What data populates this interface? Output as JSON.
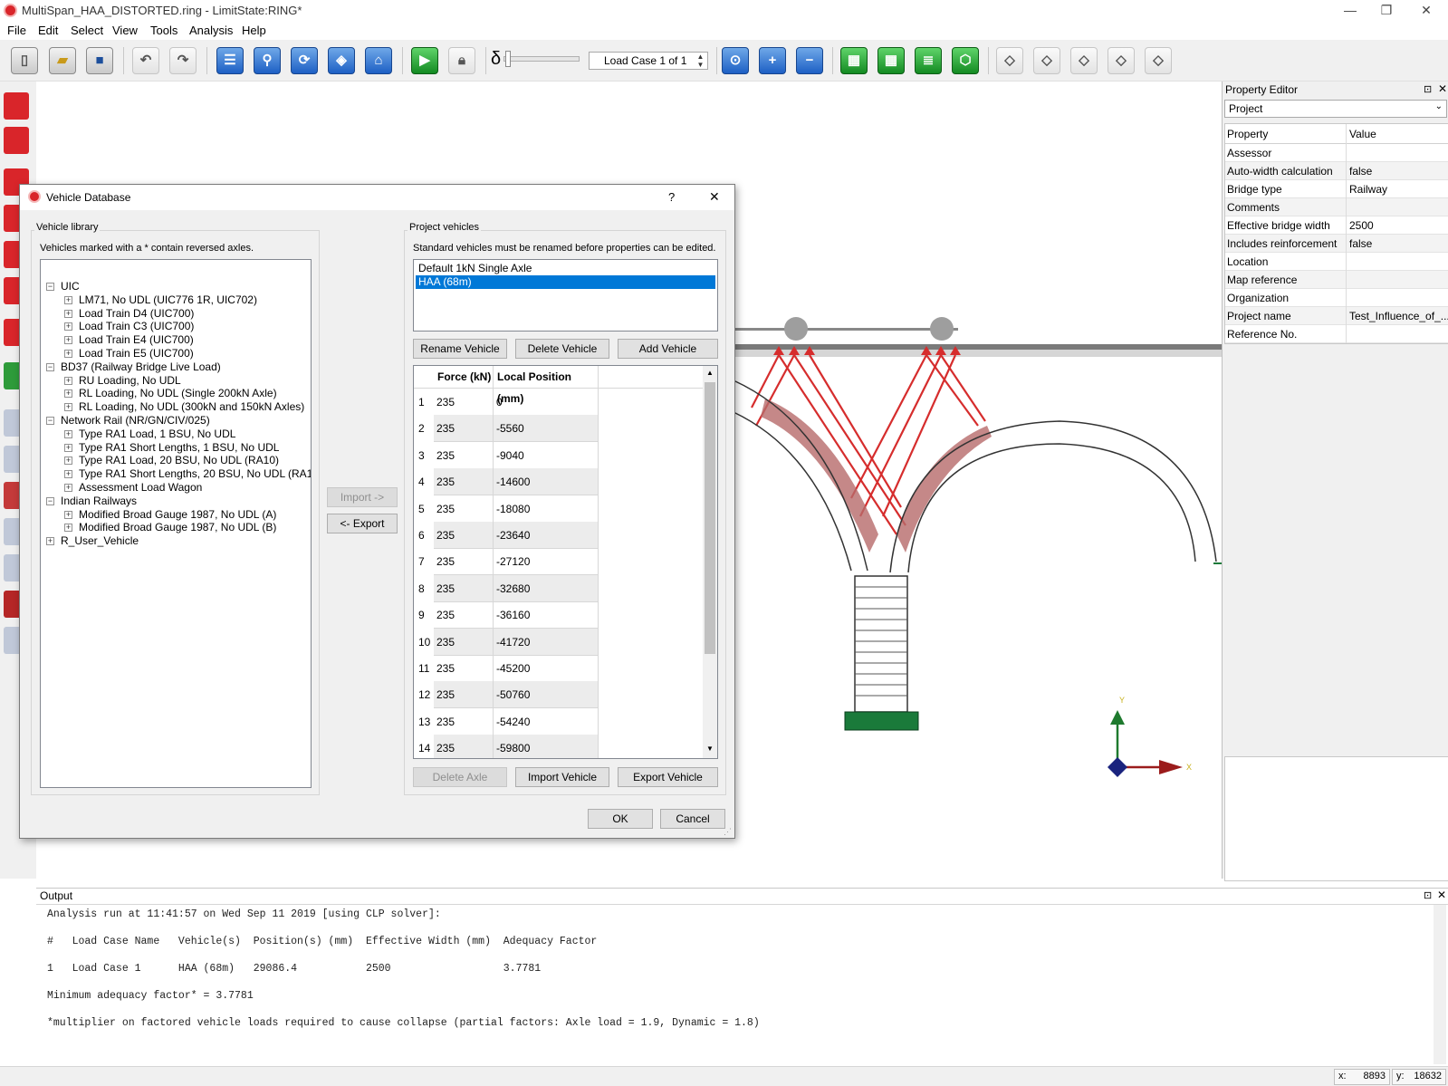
{
  "app": {
    "title": "MultiSpan_HAA_DISTORTED.ring - LimitState:RING*",
    "window_controls": [
      "—",
      "❐",
      "✕"
    ]
  },
  "menu": [
    "File",
    "Edit",
    "Select",
    "View",
    "Tools",
    "Analysis",
    "Help"
  ],
  "toolbar": {
    "delta_symbol": "δ",
    "load_case": "Load Case 1 of 1",
    "buttons": [
      "new-file",
      "open-folder",
      "save",
      "undo",
      "redo",
      "properties-sheet",
      "select-tool",
      "rotate-view",
      "tag",
      "bridge-tool",
      "run-analysis",
      "lock",
      "zoom-fit",
      "zoom-in",
      "zoom-out",
      "view-layer-1",
      "view-layer-2",
      "view-layer-3",
      "view-3d",
      "view-a",
      "view-b",
      "view-c",
      "view-d",
      "view-e"
    ]
  },
  "property_editor": {
    "title": "Property Editor",
    "selector": "Project",
    "headers": {
      "property": "Property",
      "value": "Value"
    },
    "rows": [
      {
        "property": "Assessor",
        "value": ""
      },
      {
        "property": "Auto-width calculation",
        "value": "false"
      },
      {
        "property": "Bridge type",
        "value": "Railway"
      },
      {
        "property": "Comments",
        "value": ""
      },
      {
        "property": "Effective bridge width",
        "value": "2500"
      },
      {
        "property": "Includes reinforcement",
        "value": "false"
      },
      {
        "property": "Location",
        "value": ""
      },
      {
        "property": "Map reference",
        "value": ""
      },
      {
        "property": "Organization",
        "value": ""
      },
      {
        "property": "Project name",
        "value": "Test_Influence_of_..."
      },
      {
        "property": "Reference No.",
        "value": ""
      }
    ],
    "panel_controls": [
      "⊡",
      "✕"
    ]
  },
  "dialog": {
    "title": "Vehicle Database",
    "help": "?",
    "close": "✕",
    "library": {
      "label": "Vehicle library",
      "note": "Vehicles marked with a * contain reversed axles.",
      "tree": [
        {
          "level": 0,
          "text": "UIC",
          "expander": "−"
        },
        {
          "level": 1,
          "text": "LM71, No UDL (UIC776 1R, UIC702)",
          "expander": "+"
        },
        {
          "level": 1,
          "text": "Load Train D4 (UIC700)",
          "expander": "+"
        },
        {
          "level": 1,
          "text": "Load Train C3 (UIC700)",
          "expander": "+"
        },
        {
          "level": 1,
          "text": "Load Train E4 (UIC700)",
          "expander": "+"
        },
        {
          "level": 1,
          "text": "Load Train E5 (UIC700)",
          "expander": "+"
        },
        {
          "level": 0,
          "text": "BD37 (Railway Bridge Live Load)",
          "expander": "−"
        },
        {
          "level": 1,
          "text": "RU Loading, No UDL",
          "expander": "+"
        },
        {
          "level": 1,
          "text": "RL Loading, No UDL (Single 200kN Axle)",
          "expander": "+"
        },
        {
          "level": 1,
          "text": "RL Loading, No UDL (300kN and 150kN Axles)",
          "expander": "+"
        },
        {
          "level": 0,
          "text": "Network Rail (NR/GN/CIV/025)",
          "expander": "−"
        },
        {
          "level": 1,
          "text": "Type RA1 Load, 1 BSU, No UDL",
          "expander": "+"
        },
        {
          "level": 1,
          "text": "Type RA1 Short Lengths, 1 BSU, No UDL",
          "expander": "+"
        },
        {
          "level": 1,
          "text": "Type RA1 Load, 20 BSU, No UDL (RA10)",
          "expander": "+"
        },
        {
          "level": 1,
          "text": "Type RA1 Short Lengths, 20 BSU, No UDL (RA10)",
          "expander": "+"
        },
        {
          "level": 1,
          "text": "Assessment Load Wagon",
          "expander": "+"
        },
        {
          "level": 0,
          "text": "Indian Railways",
          "expander": "−"
        },
        {
          "level": 1,
          "text": "Modified Broad Gauge 1987, No UDL (A)",
          "expander": "+"
        },
        {
          "level": 1,
          "text": "Modified Broad Gauge 1987, No UDL (B)",
          "expander": "+"
        },
        {
          "level": 0,
          "text": "R_User_Vehicle",
          "expander": "+"
        }
      ]
    },
    "import_button": "Import ->",
    "export_button": "<- Export",
    "project": {
      "label": "Project vehicles",
      "note": "Standard vehicles must be renamed before properties can be edited.",
      "vehicles": [
        "Default 1kN Single Axle",
        "HAA (68m)"
      ],
      "selected_index": 1,
      "rename_button": "Rename Vehicle",
      "delete_button": "Delete Vehicle",
      "add_button": "Add Vehicle",
      "axle_headers": [
        "Force (kN)",
        "Local Position (mm)"
      ],
      "axles": [
        {
          "n": "1",
          "force": "235",
          "position": "0"
        },
        {
          "n": "2",
          "force": "235",
          "position": "-5560"
        },
        {
          "n": "3",
          "force": "235",
          "position": "-9040"
        },
        {
          "n": "4",
          "force": "235",
          "position": "-14600"
        },
        {
          "n": "5",
          "force": "235",
          "position": "-18080"
        },
        {
          "n": "6",
          "force": "235",
          "position": "-23640"
        },
        {
          "n": "7",
          "force": "235",
          "position": "-27120"
        },
        {
          "n": "8",
          "force": "235",
          "position": "-32680"
        },
        {
          "n": "9",
          "force": "235",
          "position": "-36160"
        },
        {
          "n": "10",
          "force": "235",
          "position": "-41720"
        },
        {
          "n": "11",
          "force": "235",
          "position": "-45200"
        },
        {
          "n": "12",
          "force": "235",
          "position": "-50760"
        },
        {
          "n": "13",
          "force": "235",
          "position": "-54240"
        },
        {
          "n": "14",
          "force": "235",
          "position": "-59800"
        }
      ],
      "delete_axle_button": "Delete Axle",
      "import_vehicle_button": "Import Vehicle",
      "export_vehicle_button": "Export Vehicle"
    },
    "ok": "OK",
    "cancel": "Cancel"
  },
  "output": {
    "title": "Output",
    "lines": [
      "Analysis run at 11:41:57 on Wed Sep 11 2019 [using CLP solver]:",
      "",
      "#   Load Case Name   Vehicle(s)  Position(s) (mm)  Effective Width (mm)  Adequacy Factor",
      "",
      "1   Load Case 1      HAA (68m)   29086.4           2500                  3.7781",
      "",
      "Minimum adequacy factor* = 3.7781",
      "",
      "*multiplier on factored vehicle loads required to cause collapse (partial factors: Axle load = 1.9, Dynamic = 1.8)"
    ]
  },
  "axes": {
    "y": "Y",
    "x": "X"
  },
  "status": {
    "x_label": "x:",
    "x_value": "8893",
    "y_label": "y:",
    "y_value": "18632"
  },
  "colors": {
    "accent": "#0078d7",
    "load_lines": "#d62d2d",
    "pier_base": "#1a7a3a",
    "axis_x": "#9b1c1c",
    "axis_y": "#1e7a2e",
    "axis_z": "#1a237e"
  }
}
